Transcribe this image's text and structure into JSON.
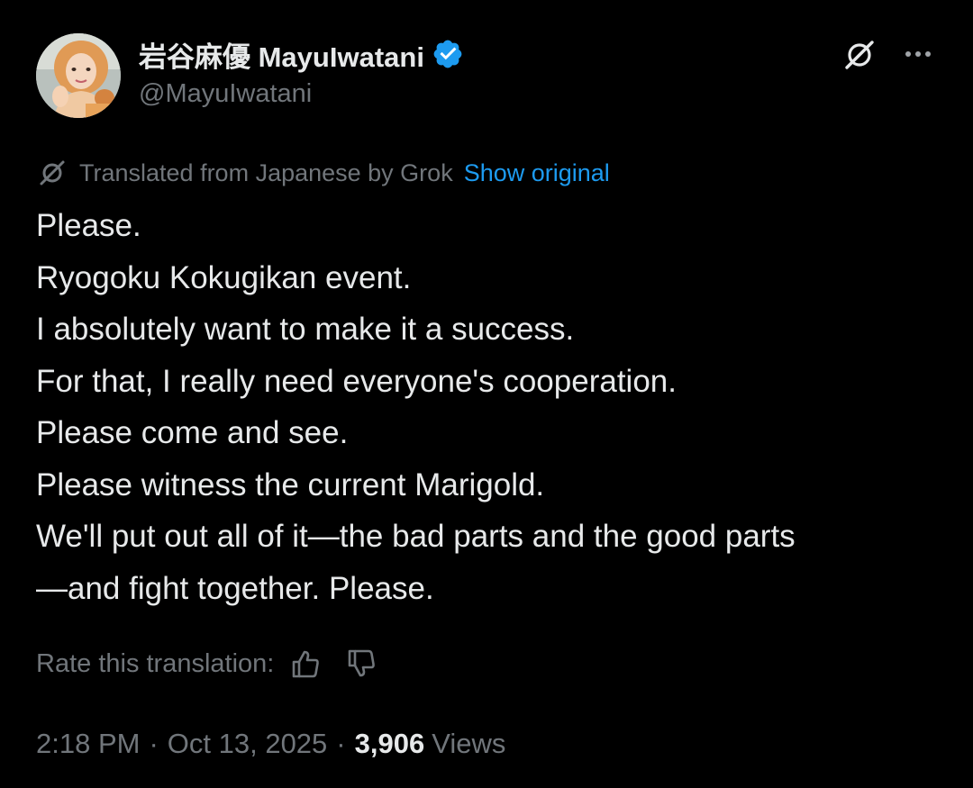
{
  "author": {
    "display_name": "岩谷麻優 MayuIwatani",
    "handle": "@MayuIwatani",
    "verified": true,
    "verified_color": "#1d9bf0"
  },
  "header_actions": {
    "grok_icon": "grok-icon",
    "more_icon": "more-icon"
  },
  "translation": {
    "label": "Translated from Japanese by Grok",
    "show_original": "Show original",
    "link_color": "#1d9bf0"
  },
  "tweet": {
    "lines": [
      "Please.",
      "Ryogoku Kokugikan event.",
      "I absolutely want to make it a success.",
      "For that, I really need everyone's cooperation.",
      "Please come and see.",
      "Please witness the current Marigold.",
      "We'll put out all of it—the bad parts and the good parts",
      "—and fight together. Please."
    ]
  },
  "rating": {
    "label": "Rate this translation:",
    "thumbs_up_icon": "thumbs-up-icon",
    "thumbs_down_icon": "thumbs-down-icon"
  },
  "meta": {
    "time": "2:18 PM",
    "separator": "·",
    "date": "Oct 13, 2025",
    "views_count": "3,906",
    "views_label": "Views"
  },
  "colors": {
    "background": "#000000",
    "primary_text": "#e7e9ea",
    "secondary_text": "#71767b",
    "accent": "#1d9bf0"
  }
}
